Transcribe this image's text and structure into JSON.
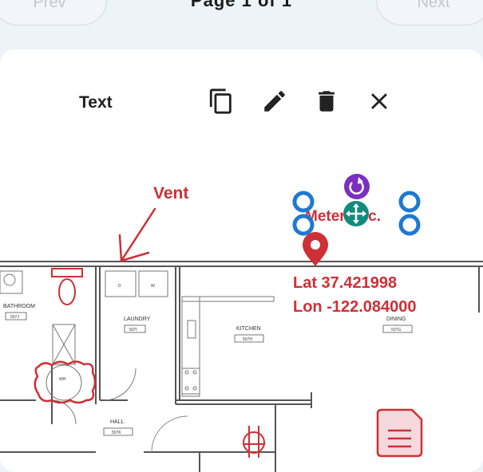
{
  "nav": {
    "prev_label": "Prev",
    "next_label": "Next",
    "page_indicator": "Page 1 of 1"
  },
  "toolbar": {
    "label": "Text",
    "icons": [
      "copy-icon",
      "edit-icon",
      "delete-icon",
      "close-icon"
    ]
  },
  "annotations": {
    "vent_label": "Vent",
    "meter_label": "Meter Loc.",
    "lat_text": "Lat 37.421998",
    "lon_text": "Lon -122.084000",
    "color": "#cf2f36"
  },
  "floorplan": {
    "rooms": [
      {
        "name": "BATHROOM",
        "code": "507J"
      },
      {
        "name": "LAUNDRY",
        "code": "507I"
      },
      {
        "name": "KITCHEN",
        "code": "507H"
      },
      {
        "name": "DINING",
        "code": "507G"
      },
      {
        "name": "HALL",
        "code": "507K"
      }
    ],
    "fixtures": {
      "washer": "D",
      "dryer": "W",
      "water_heater": "WH"
    }
  },
  "colors": {
    "handle_blue": "#1f78d1",
    "rotate_purple": "#7b2fbf",
    "move_teal": "#138a7e",
    "accent_red": "#cf2f36"
  }
}
